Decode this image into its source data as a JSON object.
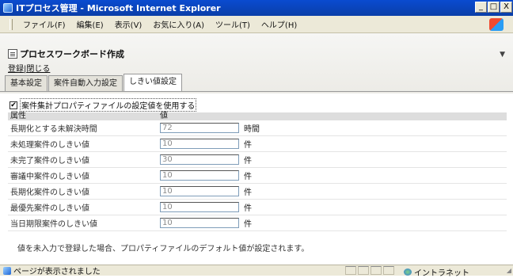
{
  "window": {
    "title": "ITプロセス管理 - Microsoft Internet Explorer",
    "buttons": [
      "_",
      "□",
      "X"
    ]
  },
  "menu": [
    "ファイル(F)",
    "編集(E)",
    "表示(V)",
    "お気に入り(A)",
    "ツール(T)",
    "ヘルプ(H)"
  ],
  "page": {
    "title": "プロセスワークボード作成",
    "links": [
      "登録",
      "閉じる"
    ],
    "tabs": [
      "基本設定",
      "案件自動入力設定",
      "しきい値設定"
    ],
    "active_tab": "しきい値設定"
  },
  "form": {
    "checkbox": {
      "checked": true,
      "label": "案件集計プロパティファイルの設定値を使用する"
    },
    "headers": [
      "属性",
      "値"
    ],
    "rows": [
      {
        "label": "長期化とする未解決時間",
        "value": "72",
        "unit": "時間"
      },
      {
        "label": "未処理案件のしきい値",
        "value": "10",
        "unit": "件"
      },
      {
        "label": "未完了案件のしきい値",
        "value": "30",
        "unit": "件"
      },
      {
        "label": "審議中案件のしきい値",
        "value": "10",
        "unit": "件"
      },
      {
        "label": "長期化案件のしきい値",
        "value": "10",
        "unit": "件"
      },
      {
        "label": "最優先案件のしきい値",
        "value": "10",
        "unit": "件"
      },
      {
        "label": "当日期限案件のしきい値",
        "value": "10",
        "unit": "件"
      }
    ],
    "note": "値を未入力で登録した場合、プロパティファイルのデフォルト値が設定されます。"
  },
  "status": {
    "text": "ページが表示されました",
    "zone": "イントラネット"
  }
}
